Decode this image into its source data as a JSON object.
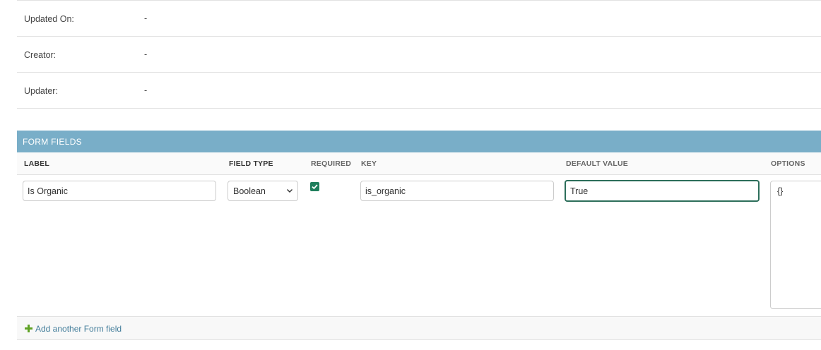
{
  "details": {
    "rows": [
      {
        "label": "Updated On:",
        "value": "-"
      },
      {
        "label": "Creator:",
        "value": "-"
      },
      {
        "label": "Updater:",
        "value": "-"
      }
    ]
  },
  "inline": {
    "title": "FORM FIELDS",
    "columns": {
      "label": "LABEL",
      "field_type": "FIELD TYPE",
      "required": "REQUIRED",
      "key": "KEY",
      "default_value": "DEFAULT VALUE",
      "options": "OPTIONS"
    },
    "row": {
      "label_value": "Is Organic",
      "field_type_value": "Boolean",
      "required_checked": true,
      "key_value": "is_organic",
      "default_value": "True",
      "options_value": "{}"
    },
    "add_link": "Add another Form field"
  },
  "colors": {
    "header_bg": "#79aec8",
    "link": "#447e9b",
    "checkbox": "#1e7e5c",
    "focus_border": "#2c6e5a",
    "add_icon": "#5fa225"
  },
  "icons": {
    "select": "chevron-down-icon",
    "checkbox": "checkmark-icon",
    "add": "plus-icon"
  }
}
